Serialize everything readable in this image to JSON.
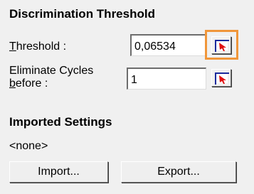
{
  "panel": {
    "title": "Discrimination Threshold",
    "threshold_label": "Threshold :",
    "threshold_value": "0,06534",
    "eliminate_label_line1": "Eliminate Cycles",
    "eliminate_label_line2": "before :",
    "eliminate_value": "1",
    "imported_title": "Imported Settings",
    "imported_value": "<none>",
    "import_label": "Import...",
    "export_label": "Export..."
  },
  "colors": {
    "highlight": "#f0963a",
    "background": "#f0f0f0"
  },
  "icons": {
    "picker": "cursor-pick-icon"
  }
}
